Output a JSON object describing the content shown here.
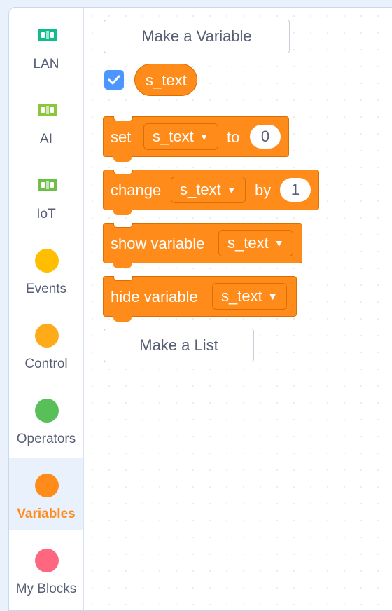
{
  "colors": {
    "variables": "#ff8c1a",
    "events": "#ffbf00",
    "control": "#ffab19",
    "operators": "#59c059",
    "myblocks": "#ff6680",
    "lan": "#0fbd8c",
    "ai": "#8cc63f",
    "iot": "#6cc04a",
    "checkbox": "#4c97ff"
  },
  "categories": [
    {
      "label": "LAN",
      "icon": "lan-device-icon"
    },
    {
      "label": "AI",
      "icon": "ai-device-icon"
    },
    {
      "label": "IoT",
      "icon": "iot-device-icon"
    },
    {
      "label": "Events",
      "icon": "events-dot-icon"
    },
    {
      "label": "Control",
      "icon": "control-dot-icon"
    },
    {
      "label": "Operators",
      "icon": "operators-dot-icon"
    },
    {
      "label": "Variables",
      "icon": "variables-dot-icon",
      "selected": true
    },
    {
      "label": "My Blocks",
      "icon": "myblocks-dot-icon"
    }
  ],
  "palette": {
    "make_variable": "Make a Variable",
    "make_list": "Make a List",
    "variable_name": "s_text",
    "variable_checked": true,
    "set_block": {
      "label": "set",
      "var": "s_text",
      "to": "to",
      "value": "0"
    },
    "change_block": {
      "label": "change",
      "var": "s_text",
      "by": "by",
      "value": "1"
    },
    "show_block": {
      "label": "show variable",
      "var": "s_text"
    },
    "hide_block": {
      "label": "hide variable",
      "var": "s_text"
    }
  }
}
